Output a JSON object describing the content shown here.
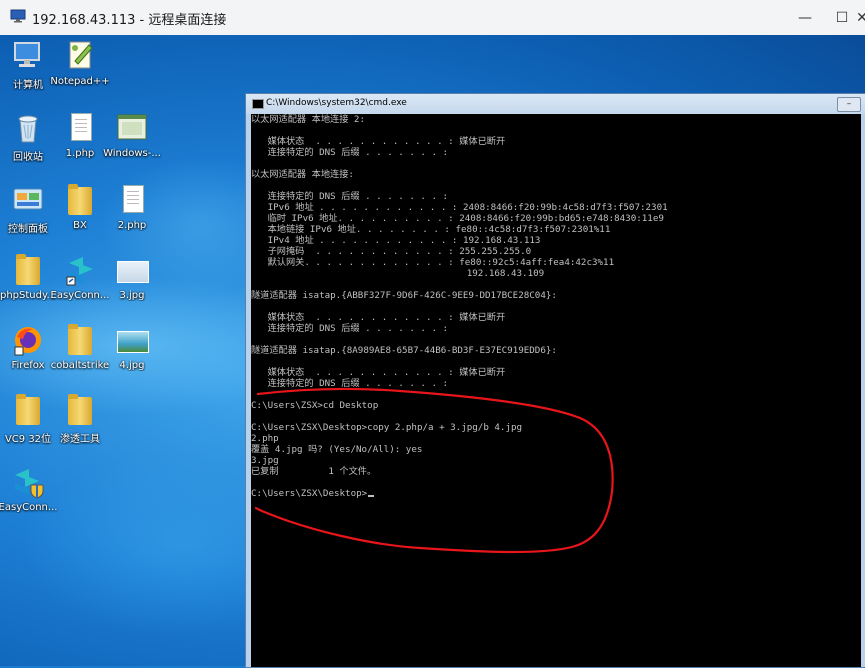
{
  "rdp": {
    "title": "192.168.43.113 - 远程桌面连接",
    "icon": "remote-desktop-icon",
    "controls": [
      "—",
      "☐",
      "✕"
    ]
  },
  "desktop_icons": [
    {
      "label": "计算机",
      "icon": "computer-icon"
    },
    {
      "label": "Notepad++",
      "icon": "notepad-plus-plus-icon"
    },
    {
      "label": "回收站",
      "icon": "recycle-bin-icon"
    },
    {
      "label": "1.php",
      "icon": "php-file-icon"
    },
    {
      "label": "Windows-...",
      "icon": "windows-app-icon"
    },
    {
      "label": "控制面板",
      "icon": "control-panel-icon"
    },
    {
      "label": "BX",
      "icon": "folder-icon"
    },
    {
      "label": "2.php",
      "icon": "php-file-icon"
    },
    {
      "label": "phpStudy...",
      "icon": "folder-shortcut-icon"
    },
    {
      "label": "EasyConn...",
      "icon": "easyconnect-icon"
    },
    {
      "label": "3.jpg",
      "icon": "image-file-icon"
    },
    {
      "label": "Firefox",
      "icon": "firefox-icon"
    },
    {
      "label": "cobaltstrike",
      "icon": "folder-icon"
    },
    {
      "label": "4.jpg",
      "icon": "image-file-icon"
    },
    {
      "label": "VC9 32位",
      "icon": "folder-icon"
    },
    {
      "label": "渗透工具",
      "icon": "folder-icon"
    },
    {
      "label": "EasyConn...",
      "icon": "easyconnect-shield-icon"
    }
  ],
  "cmd": {
    "title": "C:\\Windows\\system32\\cmd.exe",
    "lines": [
      "以太网适配器 本地连接 2:",
      "",
      "   媒体状态  . . . . . . . . . . . . : 媒体已断开",
      "   连接特定的 DNS 后缀 . . . . . . . :",
      "",
      "以太网适配器 本地连接:",
      "",
      "   连接特定的 DNS 后缀 . . . . . . . :",
      "   IPv6 地址 . . . . . . . . . . . . : 2408:8466:f20:99b:4c58:d7f3:f507:2301",
      "   临时 IPv6 地址. . . . . . . . . . : 2408:8466:f20:99b:bd65:e748:8430:11e9",
      "   本地链接 IPv6 地址. . . . . . . . : fe80::4c58:d7f3:f507:2301%11",
      "   IPv4 地址 . . . . . . . . . . . . : 192.168.43.113",
      "   子网掩码  . . . . . . . . . . . . : 255.255.255.0",
      "   默认网关. . . . . . . . . . . . . : fe80::92c5:4aff:fea4:42c3%11",
      "                                       192.168.43.109",
      "",
      "隧道适配器 isatap.{ABBF327F-9D6F-426C-9EE9-DD17BCE28C04}:",
      "",
      "   媒体状态  . . . . . . . . . . . . : 媒体已断开",
      "   连接特定的 DNS 后缀 . . . . . . . :",
      "",
      "隧道适配器 isatap.{8A989AE8-65B7-44B6-BD3F-E37EC919EDD6}:",
      "",
      "   媒体状态  . . . . . . . . . . . . : 媒体已断开",
      "   连接特定的 DNS 后缀 . . . . . . . :",
      "",
      "C:\\Users\\ZSX>cd Desktop",
      "",
      "C:\\Users\\ZSX\\Desktop>copy 2.php/a + 3.jpg/b 4.jpg",
      "2.php",
      "覆盖 4.jpg 吗? (Yes/No/All): yes",
      "3.jpg",
      "已复制         1 个文件。",
      "",
      "C:\\Users\\ZSX\\Desktop>"
    ]
  },
  "colors": {
    "annotation": "#e8151b",
    "console_bg": "#000000",
    "console_fg": "#c0c0c0"
  }
}
